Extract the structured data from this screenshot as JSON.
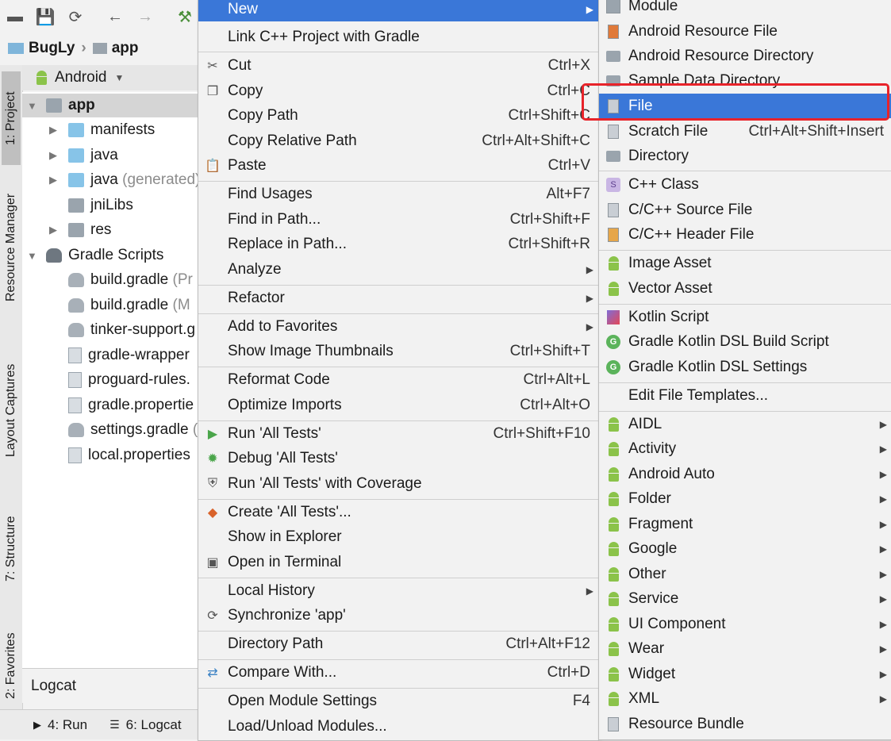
{
  "toolbar": {
    "icons": [
      "folder-icon",
      "save-icon",
      "sync-icon",
      "back-icon",
      "forward-icon",
      "hammer-icon"
    ]
  },
  "breadcrumb": {
    "project": "BugLy",
    "module": "app"
  },
  "project_panel": {
    "view_mode": "Android"
  },
  "tree": [
    {
      "label": "app",
      "bold": true
    },
    {
      "label": "manifests"
    },
    {
      "label": "java"
    },
    {
      "label": "java",
      "suffix": "(generated)"
    },
    {
      "label": "jniLibs"
    },
    {
      "label": "res"
    },
    {
      "label": "Gradle Scripts"
    },
    {
      "label": "build.gradle",
      "suffix": "(Pr"
    },
    {
      "label": "build.gradle",
      "suffix": "(M"
    },
    {
      "label": "tinker-support.g"
    },
    {
      "label": "gradle-wrapper"
    },
    {
      "label": "proguard-rules."
    },
    {
      "label": "gradle.propertie"
    },
    {
      "label": "settings.gradle",
      "suffix": "("
    },
    {
      "label": "local.properties"
    }
  ],
  "left_tabs": [
    "1: Project",
    "Resource Manager",
    "Layout Captures",
    "7: Structure",
    "2: Favorites"
  ],
  "logcat_label": "Logcat",
  "bottom_bar": {
    "run": "4: Run",
    "logcat": "6: Logcat"
  },
  "context_menu": [
    {
      "label": "New",
      "shortcut": "",
      "submenu": true,
      "highlighted": true
    },
    {
      "label": "Link C++ Project with Gradle",
      "shortcut": ""
    },
    {
      "label": "Cut",
      "shortcut": "Ctrl+X",
      "icon": "cut-icon"
    },
    {
      "label": "Copy",
      "shortcut": "Ctrl+C",
      "icon": "copy-icon"
    },
    {
      "label": "Copy Path",
      "shortcut": "Ctrl+Shift+C"
    },
    {
      "label": "Copy Relative Path",
      "shortcut": "Ctrl+Alt+Shift+C"
    },
    {
      "label": "Paste",
      "shortcut": "Ctrl+V",
      "icon": "paste-icon"
    },
    {
      "label": "Find Usages",
      "shortcut": "Alt+F7"
    },
    {
      "label": "Find in Path...",
      "shortcut": "Ctrl+Shift+F"
    },
    {
      "label": "Replace in Path...",
      "shortcut": "Ctrl+Shift+R"
    },
    {
      "label": "Analyze",
      "shortcut": "",
      "submenu": true
    },
    {
      "label": "Refactor",
      "shortcut": "",
      "submenu": true
    },
    {
      "label": "Add to Favorites",
      "shortcut": "",
      "submenu": true
    },
    {
      "label": "Show Image Thumbnails",
      "shortcut": "Ctrl+Shift+T"
    },
    {
      "label": "Reformat Code",
      "shortcut": "Ctrl+Alt+L"
    },
    {
      "label": "Optimize Imports",
      "shortcut": "Ctrl+Alt+O"
    },
    {
      "label": "Run 'All Tests'",
      "shortcut": "Ctrl+Shift+F10",
      "icon": "run-icon"
    },
    {
      "label": "Debug 'All Tests'",
      "shortcut": "",
      "icon": "debug-icon"
    },
    {
      "label": "Run 'All Tests' with Coverage",
      "shortcut": "",
      "icon": "coverage-icon"
    },
    {
      "label": "Create 'All Tests'...",
      "shortcut": "",
      "icon": "create-tests-icon"
    },
    {
      "label": "Show in Explorer",
      "shortcut": ""
    },
    {
      "label": "Open in Terminal",
      "shortcut": "",
      "icon": "terminal-icon"
    },
    {
      "label": "Local History",
      "shortcut": "",
      "submenu": true
    },
    {
      "label": "Synchronize 'app'",
      "shortcut": "",
      "icon": "sync-icon"
    },
    {
      "label": "Directory Path",
      "shortcut": "Ctrl+Alt+F12"
    },
    {
      "label": "Compare With...",
      "shortcut": "Ctrl+D",
      "icon": "compare-icon"
    },
    {
      "label": "Open Module Settings",
      "shortcut": "F4"
    },
    {
      "label": "Load/Unload Modules...",
      "shortcut": ""
    }
  ],
  "new_submenu": [
    {
      "label": "Module",
      "shortcut": "",
      "icon": "module-icon"
    },
    {
      "label": "Android Resource File",
      "shortcut": "",
      "icon": "resource-file-icon"
    },
    {
      "label": "Android Resource Directory",
      "shortcut": "",
      "icon": "folder-icon"
    },
    {
      "label": "Sample Data Directory",
      "shortcut": "",
      "icon": "folder-icon"
    },
    {
      "label": "File",
      "shortcut": "",
      "icon": "file-icon",
      "highlighted": true
    },
    {
      "label": "Scratch File",
      "shortcut": "Ctrl+Alt+Shift+Insert",
      "icon": "scratch-icon"
    },
    {
      "label": "Directory",
      "shortcut": "",
      "icon": "folder-icon"
    },
    {
      "label": "C++ Class",
      "shortcut": "",
      "icon": "cpp-class-icon"
    },
    {
      "label": "C/C++ Source File",
      "shortcut": "",
      "icon": "cpp-source-icon"
    },
    {
      "label": "C/C++ Header File",
      "shortcut": "",
      "icon": "cpp-header-icon"
    },
    {
      "label": "Image Asset",
      "shortcut": "",
      "icon": "android-icon"
    },
    {
      "label": "Vector Asset",
      "shortcut": "",
      "icon": "android-icon"
    },
    {
      "label": "Kotlin Script",
      "shortcut": "",
      "icon": "kotlin-icon"
    },
    {
      "label": "Gradle Kotlin DSL Build Script",
      "shortcut": "",
      "icon": "gradle-icon"
    },
    {
      "label": "Gradle Kotlin DSL Settings",
      "shortcut": "",
      "icon": "gradle-icon"
    },
    {
      "label": "Edit File Templates...",
      "shortcut": ""
    },
    {
      "label": "AIDL",
      "submenu": true,
      "icon": "android-icon"
    },
    {
      "label": "Activity",
      "submenu": true,
      "icon": "android-icon"
    },
    {
      "label": "Android Auto",
      "submenu": true,
      "icon": "android-icon"
    },
    {
      "label": "Folder",
      "submenu": true,
      "icon": "android-icon"
    },
    {
      "label": "Fragment",
      "submenu": true,
      "icon": "android-icon"
    },
    {
      "label": "Google",
      "submenu": true,
      "icon": "android-icon"
    },
    {
      "label": "Other",
      "submenu": true,
      "icon": "android-icon"
    },
    {
      "label": "Service",
      "submenu": true,
      "icon": "android-icon"
    },
    {
      "label": "UI Component",
      "submenu": true,
      "icon": "android-icon"
    },
    {
      "label": "Wear",
      "submenu": true,
      "icon": "android-icon"
    },
    {
      "label": "Widget",
      "submenu": true,
      "icon": "android-icon"
    },
    {
      "label": "XML",
      "submenu": true,
      "icon": "android-icon"
    },
    {
      "label": "Resource Bundle",
      "shortcut": "",
      "icon": "resource-bundle-icon"
    }
  ],
  "colors": {
    "highlight": "#3a77d8",
    "annotation_box": "#e8232a",
    "android_green": "#8bc34a"
  }
}
